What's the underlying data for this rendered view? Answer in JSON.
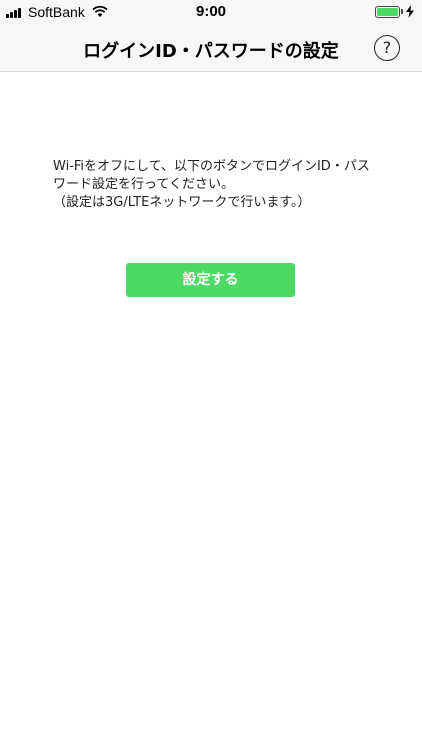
{
  "status_bar": {
    "carrier": "SoftBank",
    "time": "9:00",
    "battery_level": 1.0,
    "battery_color": "#4cd964",
    "icons": [
      "signal-icon",
      "wifi-icon",
      "battery-icon",
      "charging-bolt-icon"
    ]
  },
  "nav": {
    "title": "ログインID・パスワードの設定",
    "help_label": "?",
    "help_icon": "question-circle-icon"
  },
  "content": {
    "message_line1": "Wi-Fiをオフにして、以下のボタンでログインID・パス",
    "message_line2": "ワード設定を行ってください。",
    "message_line3": "（設定は3G/LTEネットワークで行います。）"
  },
  "setup_button": {
    "label": "設定する",
    "color": "#4cd964"
  }
}
